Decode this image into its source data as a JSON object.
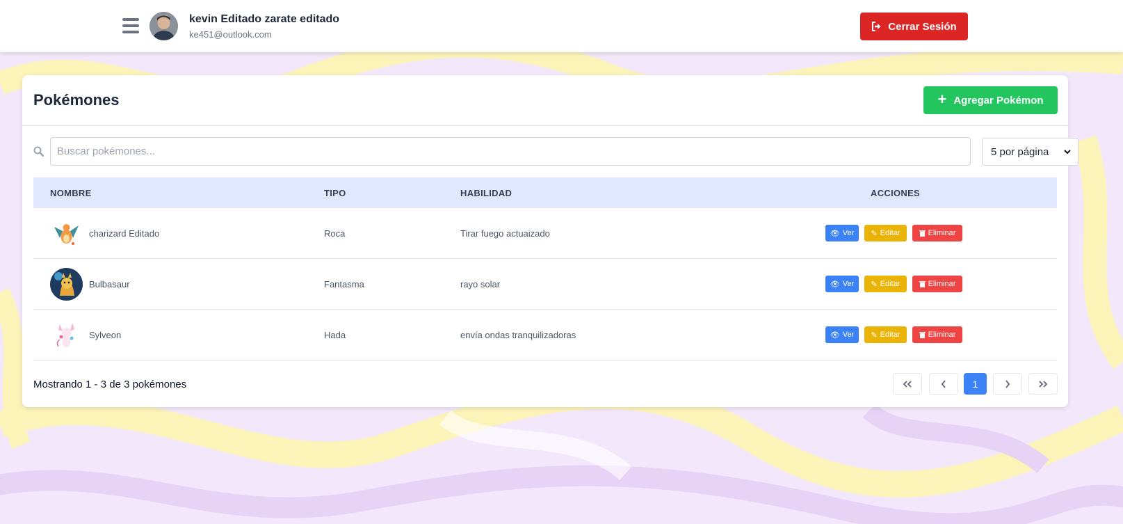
{
  "header": {
    "user_name": "kevin Editado zarate editado",
    "user_email": "ke451@outlook.com",
    "logout_label": "Cerrar Sesión"
  },
  "card": {
    "title": "Pokémones",
    "add_label": "Agregar Pokémon",
    "search_placeholder": "Buscar pokémones...",
    "page_size_value": "5 por página"
  },
  "table": {
    "headers": {
      "nombre": "NOMBRE",
      "tipo": "TIPO",
      "habilidad": "HABILIDAD",
      "acciones": "ACCIONES"
    },
    "rows": [
      {
        "nombre": "charizard Editado",
        "tipo": "Roca",
        "habilidad": "Tirar fuego actuaizado"
      },
      {
        "nombre": "Bulbasaur",
        "tipo": "Fantasma",
        "habilidad": "rayo solar"
      },
      {
        "nombre": "Sylveon",
        "tipo": "Hada",
        "habilidad": "envía ondas tranquilizadoras"
      }
    ],
    "actions": {
      "ver": "Ver",
      "editar": "Editar",
      "eliminar": "Eliminar"
    }
  },
  "footer": {
    "summary": "Mostrando 1 - 3 de 3 pokémones",
    "current_page": "1"
  },
  "colors": {
    "logout": "#dc2626",
    "add": "#22c55e",
    "ver": "#3b82f6",
    "editar": "#eab308",
    "eliminar": "#ef4444",
    "table_header": "#e0e7ff"
  }
}
